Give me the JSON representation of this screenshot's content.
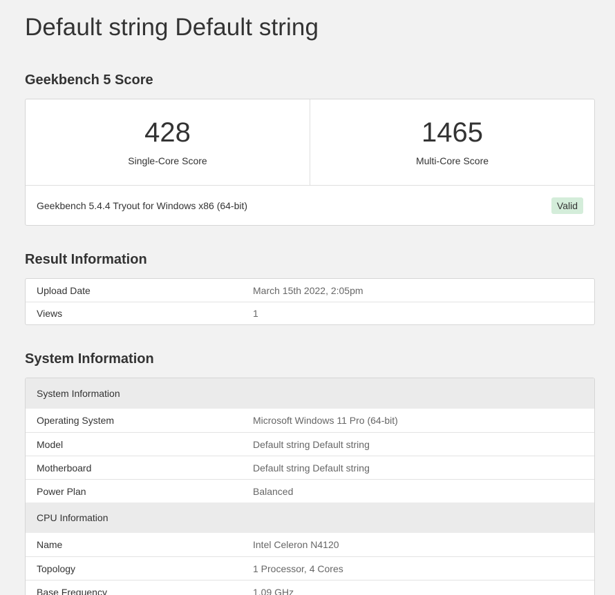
{
  "page": {
    "title": "Default string Default string"
  },
  "score_section": {
    "title": "Geekbench 5 Score",
    "single_core": {
      "value": "428",
      "label": "Single-Core Score"
    },
    "multi_core": {
      "value": "1465",
      "label": "Multi-Core Score"
    },
    "version": "Geekbench 5.4.4 Tryout for Windows x86 (64-bit)",
    "status": "Valid"
  },
  "result_section": {
    "title": "Result Information",
    "rows": [
      {
        "key": "Upload Date",
        "value": "March 15th 2022, 2:05pm"
      },
      {
        "key": "Views",
        "value": "1"
      }
    ]
  },
  "system_section": {
    "title": "System Information",
    "groups": [
      {
        "header": "System Information",
        "rows": [
          {
            "key": "Operating System",
            "value": "Microsoft Windows 11 Pro (64-bit)"
          },
          {
            "key": "Model",
            "value": "Default string Default string"
          },
          {
            "key": "Motherboard",
            "value": "Default string Default string"
          },
          {
            "key": "Power Plan",
            "value": "Balanced"
          }
        ]
      },
      {
        "header": "CPU Information",
        "rows": [
          {
            "key": "Name",
            "value": "Intel Celeron N4120"
          },
          {
            "key": "Topology",
            "value": "1 Processor, 4 Cores"
          },
          {
            "key": "Base Frequency",
            "value": "1.09 GHz"
          }
        ]
      }
    ]
  },
  "colors": {
    "valid_badge_bg": "#d4edda",
    "page_bg": "#f2f2f2",
    "group_header_bg": "#ebebeb"
  }
}
